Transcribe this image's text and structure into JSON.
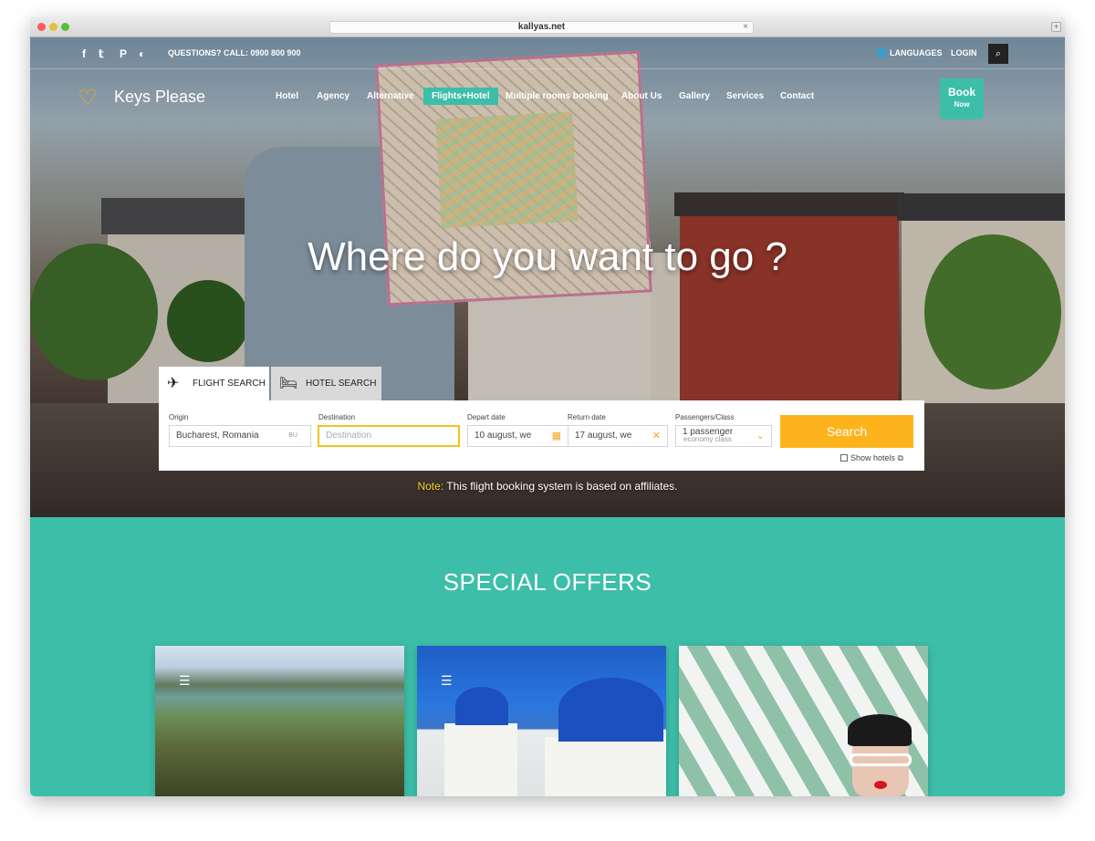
{
  "browser": {
    "url": "kallyas.net",
    "close_glyph": "×",
    "new_tab_glyph": "+"
  },
  "topbar": {
    "social_icons": [
      "facebook-icon",
      "twitter-icon",
      "pinterest-icon",
      "dribbble-icon"
    ],
    "social_glyphs": [
      "f",
      "𝕥",
      "P",
      "◐"
    ],
    "questions": "QUESTIONS? CALL: 0900 800 900",
    "languages": "LANGUAGES",
    "globe_glyph": "🌐",
    "login": "LOGIN",
    "search_glyph": "⌕"
  },
  "header": {
    "logo_glyph": "♡",
    "logo_text": "Keys Please",
    "nav": [
      "Hotel",
      "Agency",
      "Alternative",
      "Flights+Hotel",
      "Multiple rooms booking",
      "About Us",
      "Gallery",
      "Services",
      "Contact"
    ],
    "active_nav": "Flights+Hotel",
    "book_label": "Book",
    "book_sub": "Now"
  },
  "hero": {
    "headline": "Where do you want to go ?"
  },
  "booking": {
    "tabs": [
      {
        "label": "FLIGHT SEARCH",
        "glyph": "✈"
      },
      {
        "label": "HOTEL SEARCH",
        "glyph": "🛏"
      }
    ],
    "origin_label": "Origin",
    "origin_value": "Bucharest, Romania",
    "origin_code": "BU",
    "destination_label": "Destination",
    "destination_placeholder": "Destination",
    "depart_label": "Depart date",
    "depart_value": "10 august, we",
    "return_label": "Return date",
    "return_value": "17 august, we",
    "calendar_glyph": "▦",
    "clear_glyph": "✕",
    "passengers_label": "Passengers/Class",
    "passengers_value": "1 passenger",
    "passengers_class": "economy class",
    "chevron_glyph": "⌄",
    "search_label": "Search",
    "show_hotels": "Show hotels",
    "external_glyph": "⧉"
  },
  "note": {
    "prefix": "Note:",
    "text": " This flight booking system is based on affiliates."
  },
  "offers": {
    "title": "SPECIAL OFFERS",
    "menu_glyph": "☰"
  },
  "colors": {
    "teal": "#3dbea9",
    "search_yellow": "#fdb41c",
    "logo_orange": "#f6a623",
    "note_yellow": "#f2d32b"
  }
}
